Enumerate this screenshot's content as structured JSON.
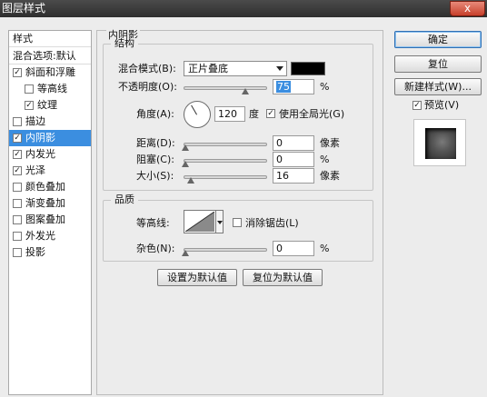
{
  "window": {
    "title": "图层样式",
    "close_label": "x"
  },
  "left_panel": {
    "header": "样式",
    "blend_options": "混合选项:默认",
    "items": [
      {
        "label": "斜面和浮雕",
        "checked": true,
        "level": "top"
      },
      {
        "label": "等高线",
        "checked": false,
        "level": "sub"
      },
      {
        "label": "纹理",
        "checked": true,
        "level": "sub"
      },
      {
        "label": "描边",
        "checked": false,
        "level": "top"
      },
      {
        "label": "内阴影",
        "checked": true,
        "level": "top",
        "selected": true
      },
      {
        "label": "内发光",
        "checked": true,
        "level": "top"
      },
      {
        "label": "光泽",
        "checked": true,
        "level": "top"
      },
      {
        "label": "颜色叠加",
        "checked": false,
        "level": "top"
      },
      {
        "label": "渐变叠加",
        "checked": false,
        "level": "top"
      },
      {
        "label": "图案叠加",
        "checked": false,
        "level": "top"
      },
      {
        "label": "外发光",
        "checked": false,
        "level": "top"
      },
      {
        "label": "投影",
        "checked": false,
        "level": "top"
      }
    ]
  },
  "main": {
    "title": "内阴影",
    "structure": {
      "title": "结构",
      "blend_mode_label": "混合模式(B):",
      "blend_mode_value": "正片叠底",
      "shadow_color": "#000000",
      "opacity_label": "不透明度(O):",
      "opacity_value": "75",
      "opacity_unit": "%",
      "opacity_fraction": 0.75,
      "angle_label": "角度(A):",
      "angle_value": "120",
      "angle_unit": "度",
      "global_light_label": "使用全局光(G)",
      "global_light_checked": true,
      "distance_label": "距离(D):",
      "distance_value": "0",
      "distance_unit": "像素",
      "choke_label": "阻塞(C):",
      "choke_value": "0",
      "choke_unit": "%",
      "size_label": "大小(S):",
      "size_value": "16",
      "size_unit": "像素"
    },
    "quality": {
      "title": "品质",
      "contour_label": "等高线:",
      "anti_alias_label": "消除锯齿(L)",
      "anti_alias_checked": false,
      "noise_label": "杂色(N):",
      "noise_value": "0",
      "noise_unit": "%"
    },
    "set_default_label": "设置为默认值",
    "reset_default_label": "复位为默认值"
  },
  "right": {
    "ok_label": "确定",
    "reset_label": "复位",
    "new_style_label": "新建样式(W)...",
    "preview_label": "预览(V)",
    "preview_checked": true
  }
}
